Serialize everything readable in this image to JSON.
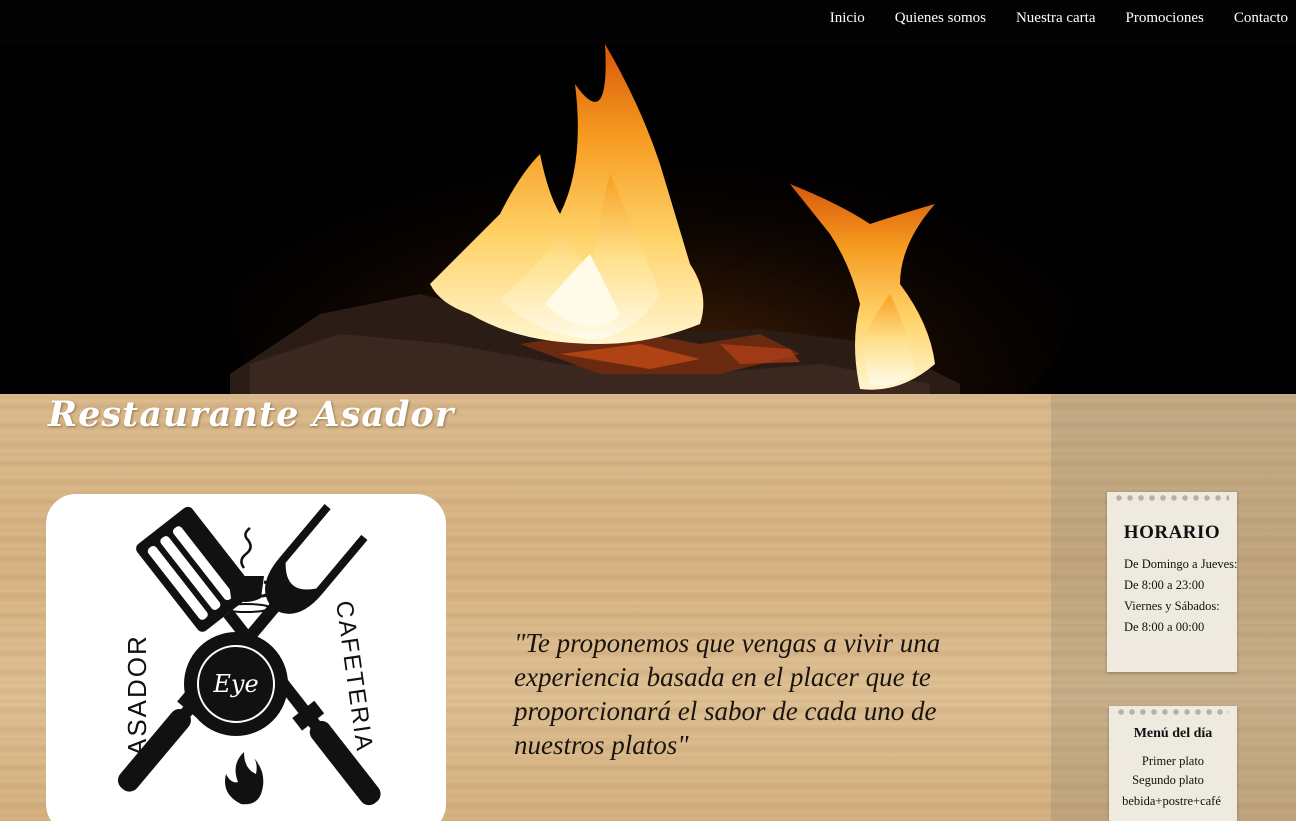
{
  "nav": {
    "items": [
      {
        "label": "Inicio"
      },
      {
        "label": "Quienes somos"
      },
      {
        "label": "Nuestra carta"
      },
      {
        "label": "Promociones"
      },
      {
        "label": "Contacto"
      }
    ]
  },
  "hero": {
    "image": "campfire-flames"
  },
  "site": {
    "title": "Restaurante Asador"
  },
  "logo": {
    "left_text": "ASADOR",
    "right_text": "CAFETERIA",
    "center_text": "Eye"
  },
  "main": {
    "quote": "\"Te proponemos que vengas a vivir una experiencia basada en el placer que te proporcionará el sabor de cada uno de nuestros platos\""
  },
  "sidebar": {
    "schedule": {
      "title": "HORARIO",
      "lines": [
        "De Domingo a Jueves:",
        "De 8:00 a 23:00",
        "Viernes y Sábados:",
        "De 8:00 a 00:00"
      ]
    },
    "menu": {
      "title": "Menú del día",
      "lines": [
        "Primer plato",
        "Segundo plato",
        "bebida+postre+café"
      ]
    }
  }
}
